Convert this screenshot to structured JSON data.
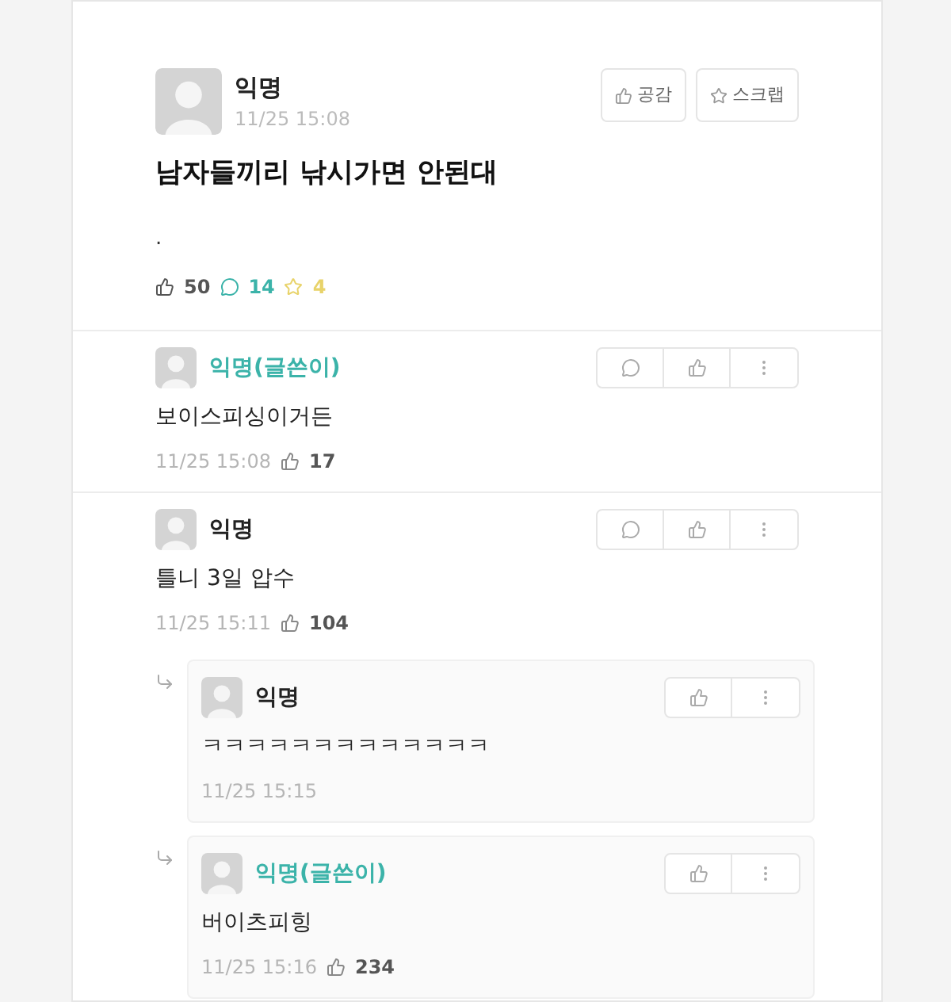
{
  "post": {
    "author": "익명",
    "time": "11/25 15:08",
    "buttons": [
      "공감",
      "스크랩"
    ],
    "title": "남자들끼리 낚시가면 안된대",
    "body": ".",
    "likes": "50",
    "comments": "14",
    "scraps": "4"
  },
  "comments": [
    {
      "kind": "comment",
      "author": "익명(글쓴이)",
      "op": true,
      "text": "보이스피싱이거든",
      "time": "11/25 15:08",
      "likes": "17"
    },
    {
      "kind": "comment",
      "author": "익명",
      "op": false,
      "text": "틀니 3일 압수",
      "time": "11/25 15:11",
      "likes": "104"
    },
    {
      "kind": "reply",
      "author": "익명",
      "op": false,
      "text": "ㅋㅋㅋㅋㅋㅋㅋㅋㅋㅋㅋㅋㅋ",
      "time": "11/25 15:15"
    },
    {
      "kind": "reply",
      "author": "익명(글쓴이)",
      "op": true,
      "text": "버이츠피힝",
      "time": "11/25 15:16",
      "likes": "234"
    }
  ]
}
